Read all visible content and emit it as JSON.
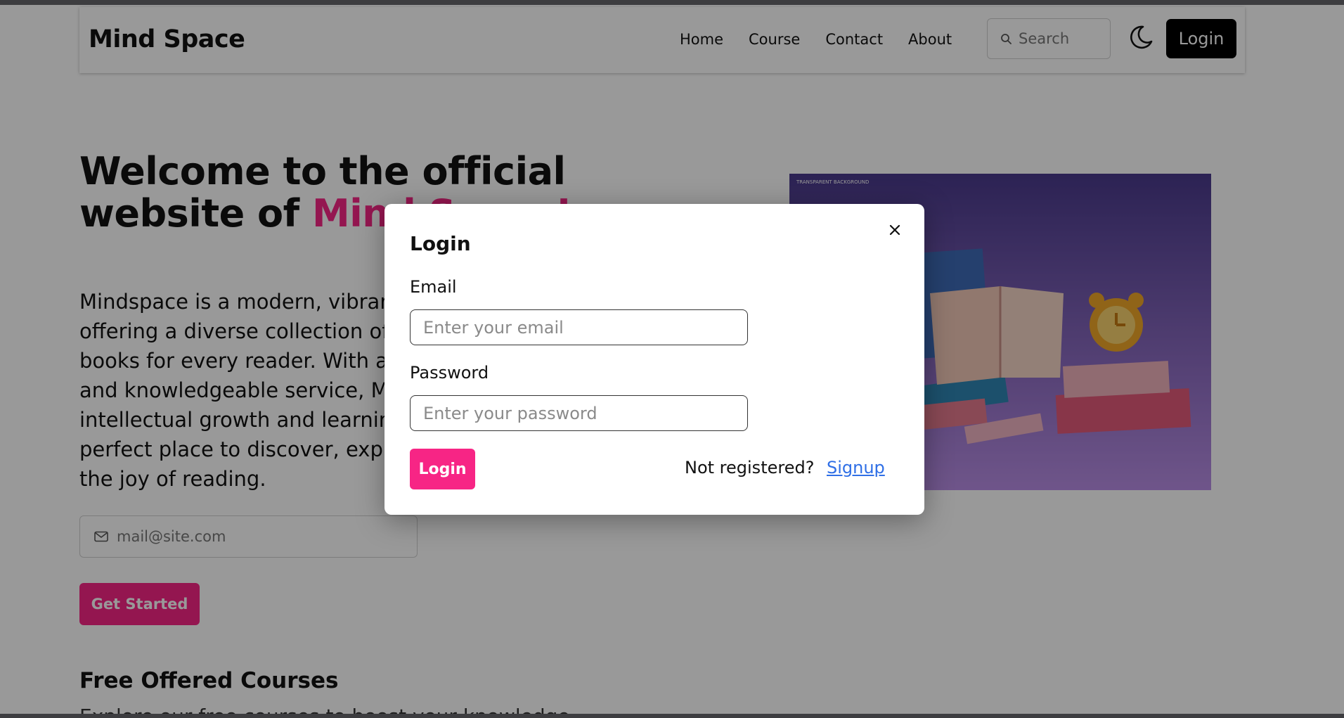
{
  "header": {
    "brand": "Mind Space",
    "nav": [
      "Home",
      "Course",
      "Contact",
      "About"
    ],
    "search_placeholder": "Search",
    "login_label": "Login"
  },
  "hero": {
    "title_line1": "Welcome to the official",
    "title_line2_prefix": "website of ",
    "title_highlight": "Mind Space!",
    "paragraph": "Mindspace is a modern, vibrant bookstore offering a diverse collection of carefully curated books for every reader. With a warm atmosphere and knowledgeable service, Mindspace inspires intellectual growth and learning, making it the perfect place to discover, explore, and celebrate the joy of reading.",
    "email_placeholder": "mail@site.com",
    "cta_label": "Get Started",
    "image_watermark": "TRANSPARENT BACKGROUND"
  },
  "courses": {
    "title": "Free Offered Courses",
    "subtitle": "Explore our free courses to boost your knowledge"
  },
  "modal": {
    "title": "Login",
    "email_label": "Email",
    "email_placeholder": "Enter your email",
    "password_label": "Password",
    "password_placeholder": "Enter your password",
    "login_button": "Login",
    "not_registered": "Not registered?",
    "signup_link": "Signup"
  },
  "colors": {
    "accent": "#f72585",
    "link": "#2f6fe6",
    "overlay": "rgba(0,0,0,0.40)"
  }
}
